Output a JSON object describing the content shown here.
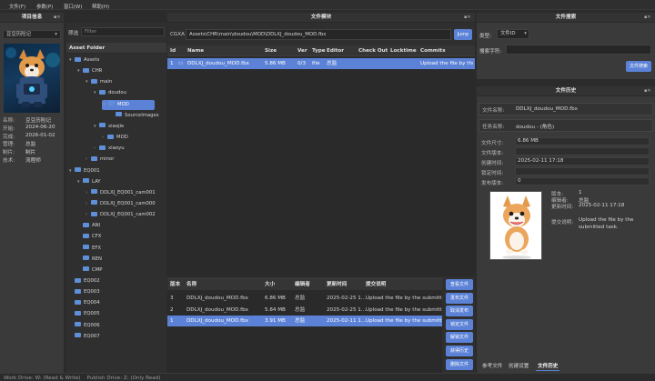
{
  "menu": [
    "文件(F)",
    "参数(P)",
    "窗口(W)",
    "帮助(H)"
  ],
  "left": {
    "title": "项目信息",
    "project_select": "豆豆历险记",
    "info": [
      {
        "label": "名称:",
        "value": "豆豆历险记"
      },
      {
        "label": "开始:",
        "value": "2024-06-20"
      },
      {
        "label": "完成:",
        "value": "2026-01-02"
      },
      {
        "label": "管理:",
        "value": "总监"
      },
      {
        "label": "制片:",
        "value": "制片"
      },
      {
        "label": "技术:",
        "value": "流程师"
      }
    ]
  },
  "asset": {
    "filter_label": "筛选",
    "filter_placeholder": "Filter",
    "folder_header": "Asset Folder",
    "tree": [
      {
        "label": "Assets",
        "level": 0,
        "arrow": "▾"
      },
      {
        "label": "CHR",
        "level": 1,
        "arrow": "▾"
      },
      {
        "label": "main",
        "level": 2,
        "arrow": "▾"
      },
      {
        "label": "doudou",
        "level": 3,
        "arrow": "▾"
      },
      {
        "label": "MOD",
        "level": 4,
        "arrow": "▾",
        "selected": true
      },
      {
        "label": "SourceImages",
        "level": 5,
        "arrow": ""
      },
      {
        "label": "xiaojie",
        "level": 3,
        "arrow": "▾"
      },
      {
        "label": "MOD",
        "level": 4,
        "arrow": "›"
      },
      {
        "label": "xiaoyu",
        "level": 3,
        "arrow": "›"
      },
      {
        "label": "minor",
        "level": 2,
        "arrow": "›"
      },
      {
        "label": "EQ001",
        "level": 0,
        "arrow": "▾"
      },
      {
        "label": "LAY",
        "level": 1,
        "arrow": "▾"
      },
      {
        "label": "DDLXJ_EQ001_cam001",
        "level": 2,
        "arrow": "›"
      },
      {
        "label": "DDLXJ_EQ001_cam000",
        "level": 2,
        "arrow": "›"
      },
      {
        "label": "DDLXJ_EQ001_cam002",
        "level": 2,
        "arrow": "›"
      },
      {
        "label": "ANI",
        "level": 1,
        "arrow": ""
      },
      {
        "label": "CFX",
        "level": 1,
        "arrow": ""
      },
      {
        "label": "EFX",
        "level": 1,
        "arrow": ""
      },
      {
        "label": "REN",
        "level": 1,
        "arrow": ""
      },
      {
        "label": "CMP",
        "level": 1,
        "arrow": ""
      },
      {
        "label": "EQ002",
        "level": 0,
        "arrow": ""
      },
      {
        "label": "EQ003",
        "level": 0,
        "arrow": ""
      },
      {
        "label": "EQ004",
        "level": 0,
        "arrow": ""
      },
      {
        "label": "EQ005",
        "level": 0,
        "arrow": ""
      },
      {
        "label": "EQ006",
        "level": 0,
        "arrow": ""
      },
      {
        "label": "EQ007",
        "level": 0,
        "arrow": ""
      }
    ]
  },
  "files": {
    "title": "文件模块",
    "path_label": "CGXA",
    "path": "Assets\\CHR\\main\\doudou\\MOD\\DDLXJ_doudou_MOD.fbx",
    "jump": "Jump",
    "columns": [
      "Id",
      "Name",
      "Size",
      "Ver",
      "Type",
      "Editor",
      "Check Out",
      "Locktime",
      "Commits"
    ],
    "rows": [
      [
        "1",
        "DDLXJ_doudou_MOD.fbx",
        "5.86 MB",
        "0/3",
        "file",
        "总监",
        "",
        "",
        "Upload the file by the..."
      ]
    ]
  },
  "versions": {
    "columns": [
      "版本",
      "名称",
      "大小",
      "编辑者",
      "更新时间",
      "提交说明"
    ],
    "rows": [
      [
        "3",
        "DDLXJ_doudou_MOD.fbx",
        "6.86 MB",
        "总监",
        "2025-02-25 1...",
        "Upload the file by the submitte..."
      ],
      [
        "2",
        "DDLXJ_doudou_MOD.fbx",
        "5.84 MB",
        "总监",
        "2025-02-25 1...",
        "Upload the file by the submitte..."
      ],
      [
        "1",
        "DDLXJ_doudou_MOD.fbx",
        "3.91 MB",
        "总监",
        "2025-02-11 1...",
        "Upload the file by the submitte..."
      ]
    ],
    "buttons": [
      "查看文件",
      "发布文件",
      "取消发布",
      "锁定文件",
      "解锁文件",
      "获得历史",
      "删除文件"
    ]
  },
  "search": {
    "title": "文件搜索",
    "type_label": "类型:",
    "type_value": "文件ID",
    "keyword_label": "搜索字符:",
    "button": "文件搜索"
  },
  "history": {
    "title": "文件历史",
    "fields": [
      {
        "label": "文件名称:",
        "value": "DDLXJ_doudou_MOD.fbx"
      },
      {
        "label": "任务名称:",
        "value": "doudou - (角色)"
      }
    ],
    "props": [
      {
        "label": "文件尺寸:",
        "value": "6.86 MB"
      },
      {
        "label": "文件版本:",
        "value": ""
      },
      {
        "label": "创建时间:",
        "value": "2025-02-11 17:18"
      },
      {
        "label": "锁定时间:",
        "value": ""
      },
      {
        "label": "发布版本:",
        "value": "0"
      }
    ],
    "version_info": [
      {
        "label": "版本:",
        "value": "1"
      },
      {
        "label": "编辑者:",
        "value": "总监"
      },
      {
        "label": "更新时间:",
        "value": "2025-02-11 17:18"
      }
    ],
    "note_label": "提交说明:",
    "note": "Upload the file by the submitted task.",
    "tabs": [
      "参考文件",
      "创建设置",
      "文件历史"
    ]
  },
  "status": "Work Drive: W: (Read & Write)    Publish Drive: Z: (Only Read)"
}
